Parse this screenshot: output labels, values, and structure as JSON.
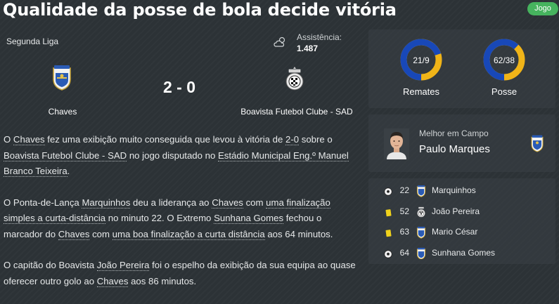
{
  "headline": "Qualidade da posse de bola decide vitória",
  "badge": "Jogo",
  "match": {
    "competition": "Segunda Liga",
    "weather_icon": "cloudy-weather-icon",
    "attendance_label": "Assistência:",
    "attendance_value": "1.487",
    "score": "2 - 0",
    "home_team": "Chaves",
    "away_team": "Boavista Futebol Clube - SAD"
  },
  "stats": {
    "shots": {
      "value": "21/9",
      "label": "Remates",
      "home": 21,
      "away": 9
    },
    "possession": {
      "value": "62/38",
      "label": "Posse",
      "home": 62,
      "away": 38
    },
    "home_color": "#1848b8",
    "away_color": "#f0b418"
  },
  "motm": {
    "label": "Melhor em Campo",
    "name": "Paulo Marques"
  },
  "events": [
    {
      "icon": "goal-icon",
      "minute": "22",
      "player": "Marquinhos",
      "team": "home"
    },
    {
      "icon": "yellow-card-icon",
      "minute": "52",
      "player": "João Pereira",
      "team": "away"
    },
    {
      "icon": "yellow-card-icon",
      "minute": "63",
      "player": "Mario César",
      "team": "home"
    },
    {
      "icon": "goal-icon",
      "minute": "64",
      "player": "Sunhana Gomes",
      "team": "home"
    }
  ],
  "report": {
    "p1": {
      "t1": "O ",
      "l1": "Chaves",
      "t2": " fez uma exibição muito conseguida que levou à vitória de ",
      "l2": "2-0",
      "t3": " sobre o ",
      "l3": "Boavista Futebol Clube - SAD",
      "t4": " no jogo disputado no ",
      "l4": "Estádio Municipal Eng.º Manuel Branco Teixeira",
      "t5": "."
    },
    "p2": {
      "t1": "O Ponta-de-Lança ",
      "l1": "Marquinhos",
      "t2": " deu a liderança ao ",
      "l2": "Chaves",
      "t3": " com ",
      "l3": "uma finalização simples a curta-distância",
      "t4": " no minuto 22. O Extremo ",
      "l4": "Sunhana Gomes",
      "t5": " fechou o marcador do ",
      "l5": "Chaves",
      "t6": " com ",
      "l6": "uma boa finalização a curta distância",
      "t7": " aos 64 minutos."
    },
    "p3": {
      "t1": "O capitão do Boavista ",
      "l1": "João Pereira",
      "t2": " foi o espelho da exibição da sua equipa ao quase oferecer outro golo ao ",
      "l2": "Chaves",
      "t3": " aos 86 minutos."
    }
  }
}
